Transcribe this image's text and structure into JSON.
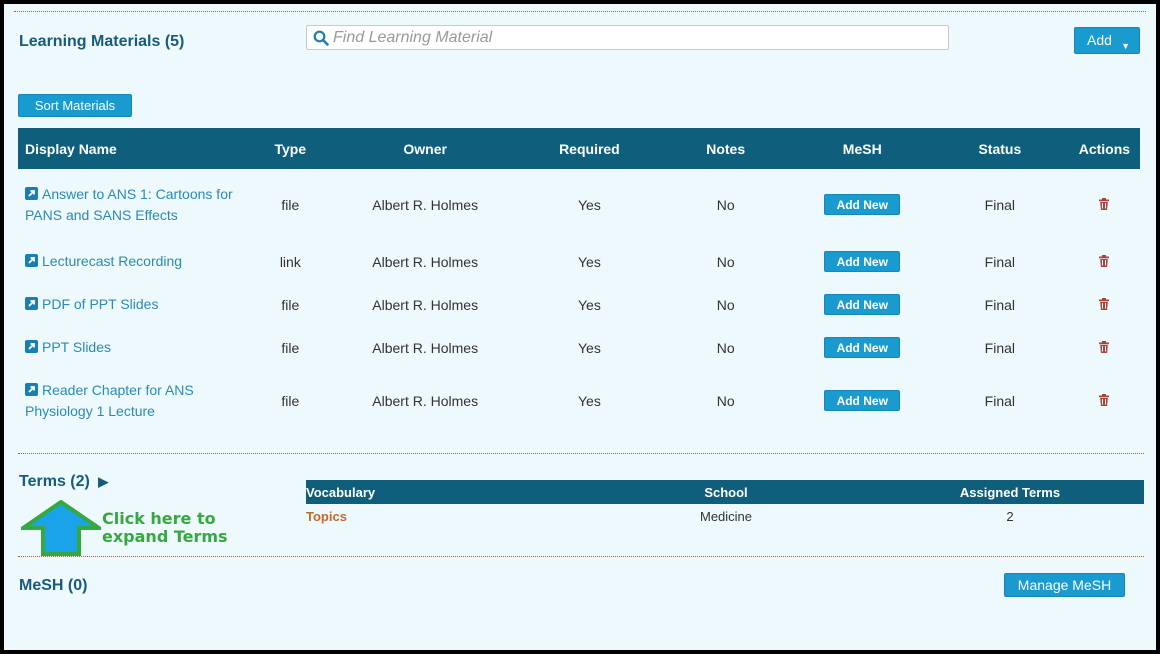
{
  "learning_materials": {
    "title": "Learning Materials (5)",
    "search_placeholder": "Find Learning Material",
    "add_label": "Add",
    "sort_label": "Sort Materials",
    "columns": [
      "Display Name",
      "Type",
      "Owner",
      "Required",
      "Notes",
      "MeSH",
      "Status",
      "Actions"
    ],
    "rows": [
      {
        "name": "Answer to ANS 1: Cartoons for PANS and SANS Effects",
        "type": "file",
        "owner": "Albert R. Holmes",
        "required": "Yes",
        "notes": "No",
        "mesh": "Add New",
        "status": "Final"
      },
      {
        "name": "Lecturecast Recording",
        "type": "link",
        "owner": "Albert R. Holmes",
        "required": "Yes",
        "notes": "No",
        "mesh": "Add New",
        "status": "Final"
      },
      {
        "name": "PDF of PPT Slides",
        "type": "file",
        "owner": "Albert R. Holmes",
        "required": "Yes",
        "notes": "No",
        "mesh": "Add New",
        "status": "Final"
      },
      {
        "name": "PPT Slides",
        "type": "file",
        "owner": "Albert R. Holmes",
        "required": "Yes",
        "notes": "No",
        "mesh": "Add New",
        "status": "Final"
      },
      {
        "name": "Reader Chapter for ANS Physiology 1 Lecture",
        "type": "file",
        "owner": "Albert R. Holmes",
        "required": "Yes",
        "notes": "No",
        "mesh": "Add New",
        "status": "Final"
      }
    ]
  },
  "terms": {
    "title": "Terms (2)",
    "expand_glyph": "▶",
    "columns": [
      "Vocabulary",
      "School",
      "Assigned Terms"
    ],
    "rows": [
      {
        "vocabulary": "Topics",
        "school": "Medicine",
        "assigned": "2"
      }
    ],
    "annotation_line1": "Click here to",
    "annotation_line2": "expand Terms"
  },
  "mesh": {
    "title": "MeSH (0)",
    "manage_label": "Manage MeSH"
  },
  "colors": {
    "background": "#eef9fd",
    "header": "#0f5f7c",
    "button": "#1a9bd0",
    "link": "#2a8ab4",
    "yes": "#6aab4d",
    "no": "#a9443a",
    "annotation": "#35a83f",
    "arrow_fill": "#1aa3e8"
  },
  "icons": [
    "search-icon",
    "external-link-icon",
    "trash-icon",
    "caret-down-icon",
    "expand-arrow-icon",
    "up-arrow-annotation"
  ]
}
